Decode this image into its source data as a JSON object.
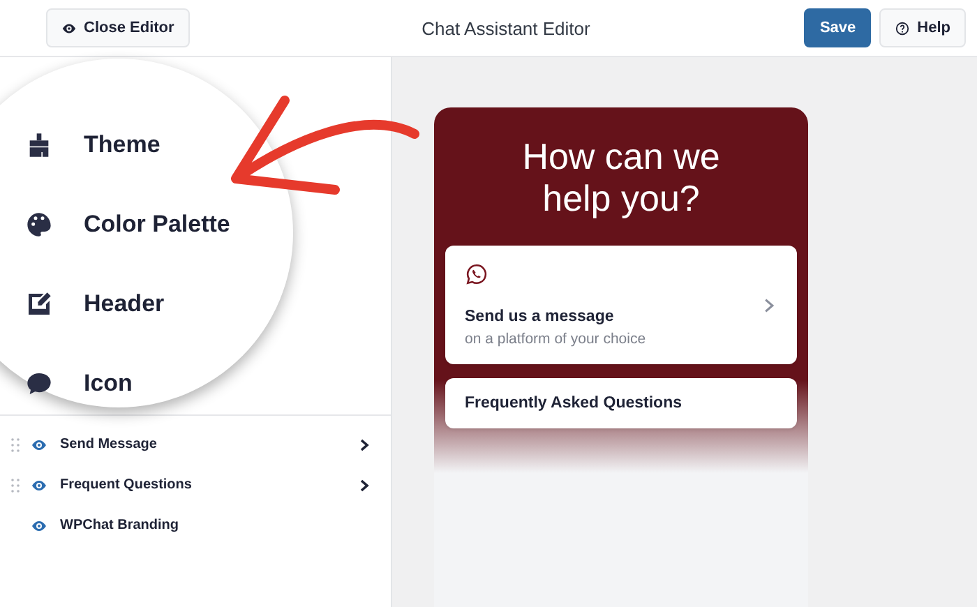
{
  "topbar": {
    "close_button": "Close Editor",
    "title": "Chat Assistant Editor",
    "save_button": "Save",
    "help_button": "Help"
  },
  "magnified_menu": [
    {
      "label": "Theme",
      "kind": "brush"
    },
    {
      "label": "Color Palette",
      "kind": "palette"
    },
    {
      "label": "Header",
      "kind": "edit"
    },
    {
      "label": "Icon",
      "kind": "chat"
    }
  ],
  "sections": [
    {
      "label": "Send Message",
      "draggable": true,
      "expandable": true
    },
    {
      "label": "Frequent Questions",
      "draggable": true,
      "expandable": true
    },
    {
      "label": "WPChat Branding",
      "draggable": false,
      "expandable": false
    }
  ],
  "preview": {
    "heading": "How can we help you?",
    "cards": [
      {
        "title": "Send us a message",
        "subtitle": "on a platform of your choice",
        "kind": "whatsapp",
        "expandable": true
      },
      {
        "title": "Frequently Asked Questions",
        "expandable": false
      }
    ]
  }
}
